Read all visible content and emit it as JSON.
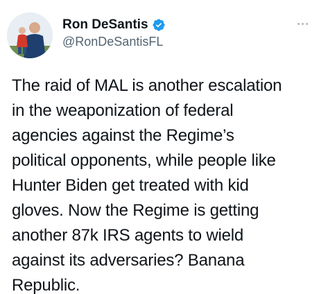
{
  "tweet": {
    "author": {
      "display_name": "Ron DeSantis",
      "handle": "@RonDeSantisFL",
      "verified": true,
      "avatar_icon": "profile-photo"
    },
    "more_icon": "more-options-icon",
    "text_lines": [
      "The raid of MAL is another escalation",
      "in the weaponization of federal",
      "agencies against the Regime’s",
      "political opponents, while people like",
      "Hunter Biden get treated with kid",
      "gloves. Now the Regime is getting",
      "another 87k IRS agents to wield",
      "against its adversaries? Banana",
      "Republic."
    ]
  },
  "colors": {
    "text": "#0f1419",
    "secondary": "#536471",
    "verified": "#1d9bf0",
    "background": "#ffffff"
  }
}
